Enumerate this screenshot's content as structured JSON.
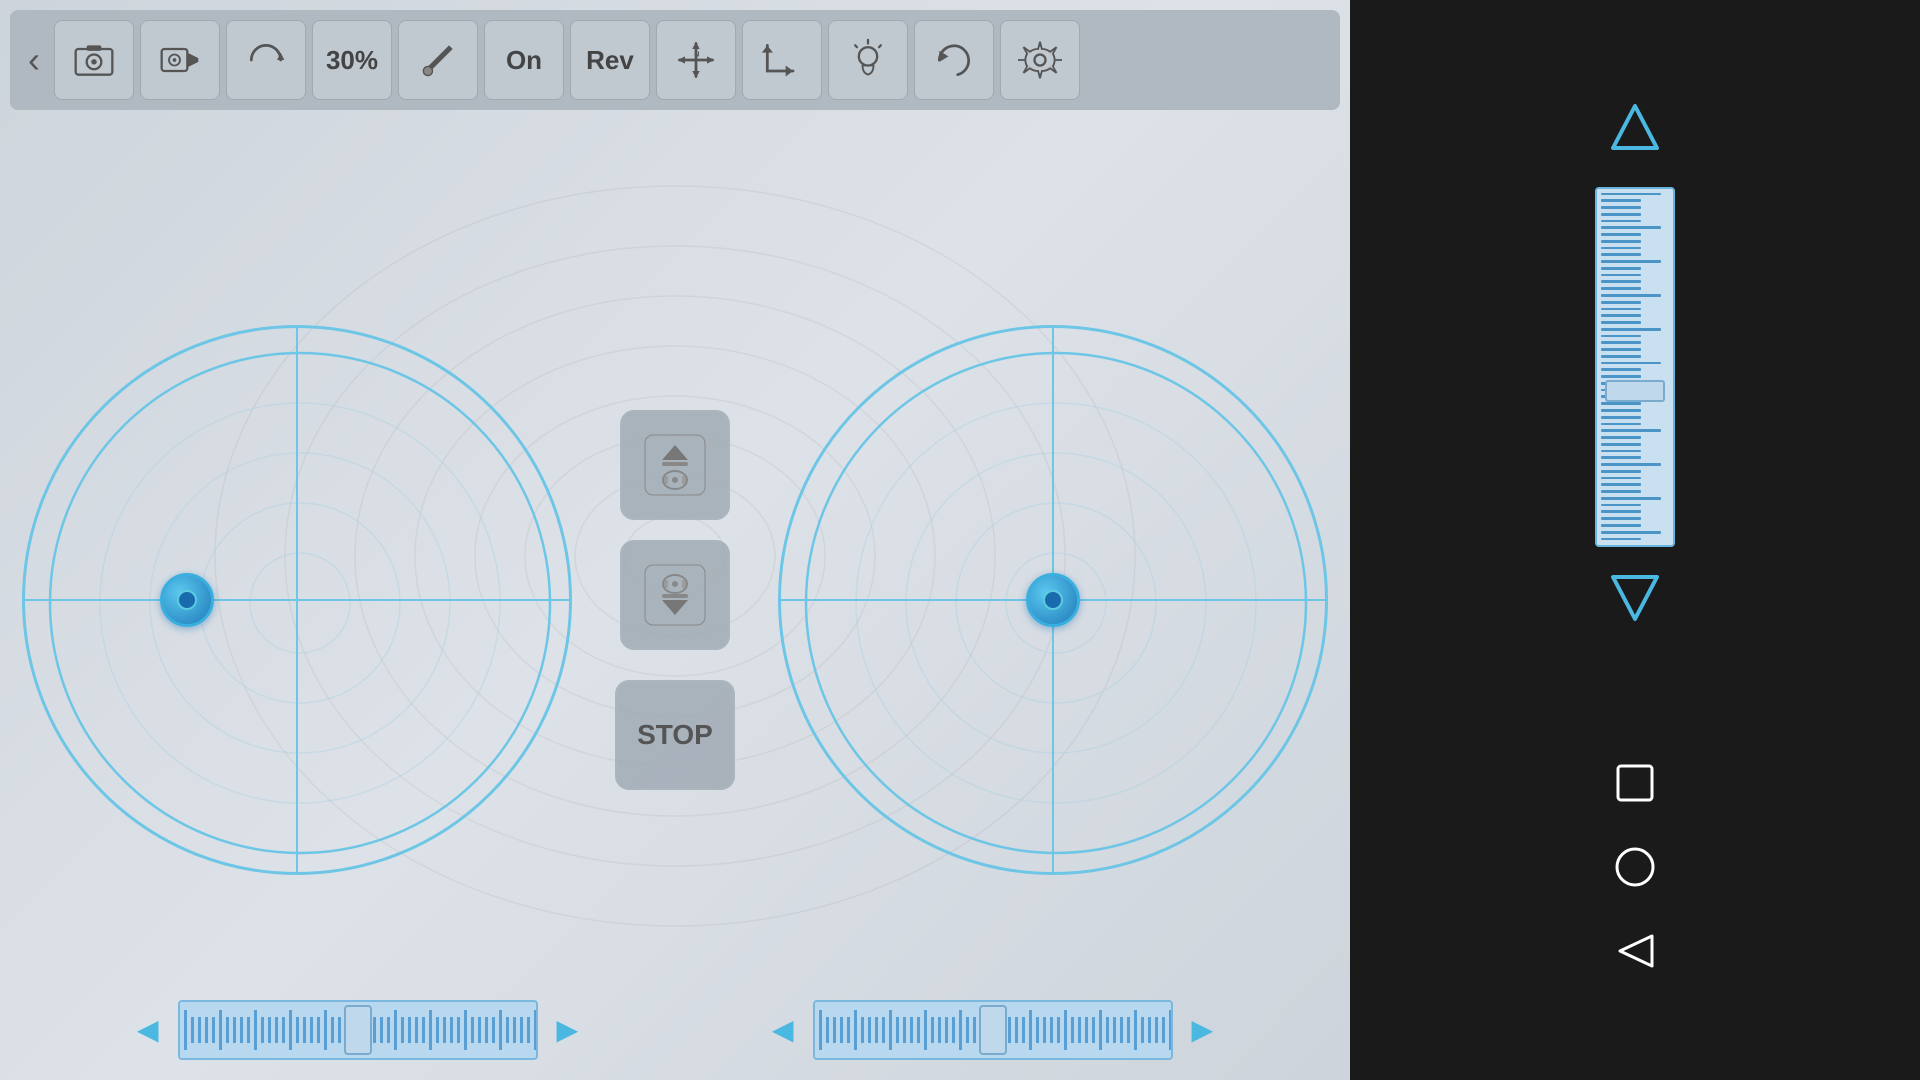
{
  "toolbar": {
    "back_label": "‹",
    "camera_btn": "camera",
    "video_btn": "video",
    "rotate_btn": "rotate",
    "percent_label": "30%",
    "brush_btn": "brush",
    "on_label": "On",
    "rev_label": "Rev",
    "move_btn": "move",
    "corner_btn": "corner",
    "light_btn": "light",
    "reload_btn": "reload",
    "settings_btn": "settings"
  },
  "controls": {
    "up_btn": "scroll-up",
    "down_btn": "scroll-down",
    "stop_label": "STOP"
  },
  "bottom": {
    "left_arrow_left": "◄",
    "left_arrow_right": "►",
    "right_arrow_left": "◄",
    "right_arrow_right": "►"
  },
  "vertical_slider": {
    "up_arrow": "▲",
    "down_arrow": "▼"
  },
  "android_nav": {
    "square_label": "□",
    "circle_label": "○",
    "back_label": "◁"
  }
}
